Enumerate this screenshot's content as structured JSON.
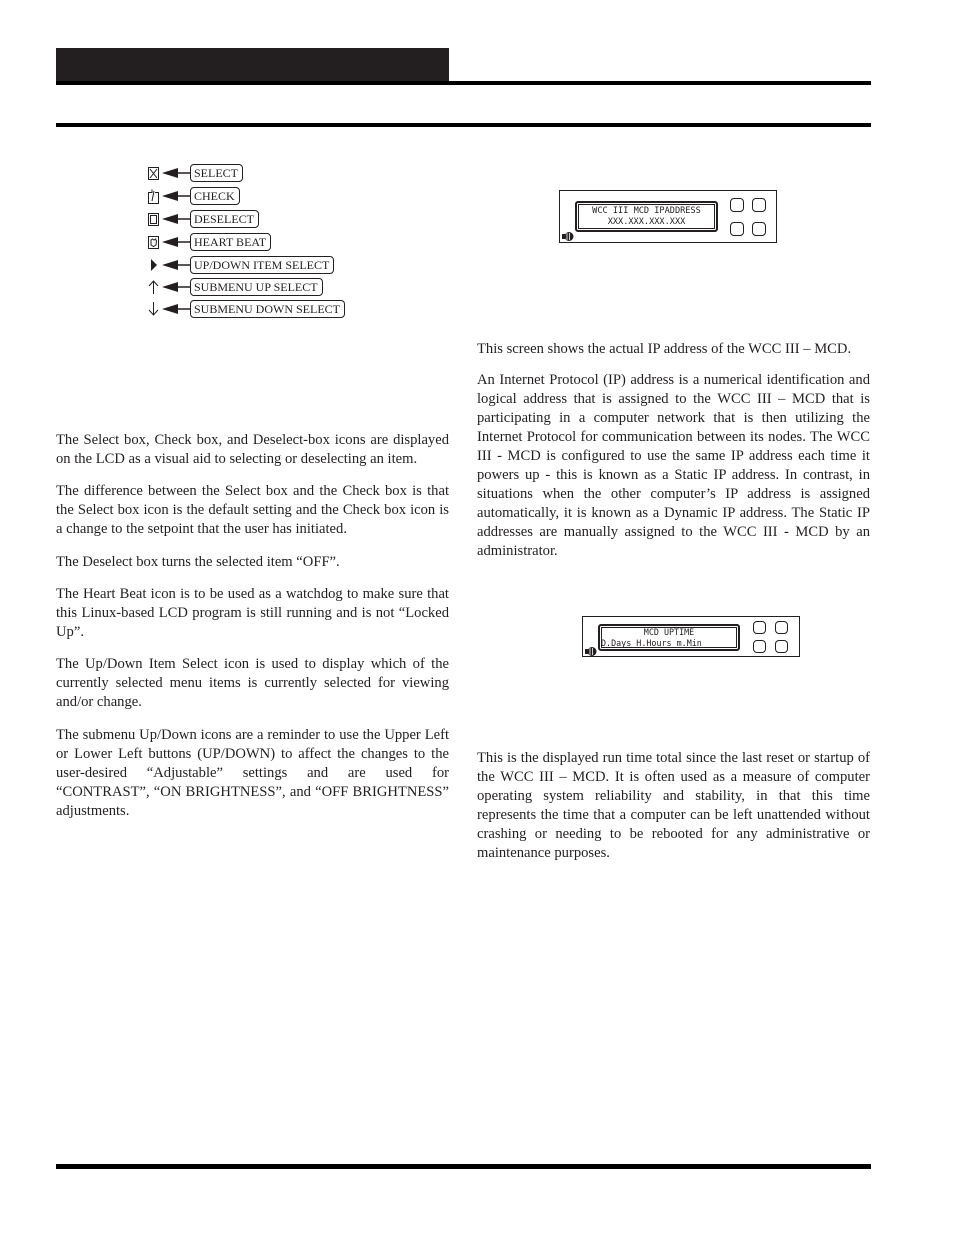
{
  "page": {
    "header_bar_color": "#231f20"
  },
  "legend": {
    "items": [
      {
        "icon": "select-box-icon",
        "label": "SELECT"
      },
      {
        "icon": "check-box-icon",
        "label": "CHECK"
      },
      {
        "icon": "deselect-box-icon",
        "label": "DESELECT"
      },
      {
        "icon": "heart-beat-icon",
        "label": "HEART BEAT"
      },
      {
        "icon": "up-down-item-select-icon",
        "label": "UP/DOWN ITEM SELECT"
      },
      {
        "icon": "submenu-up-arrow-icon",
        "label": "SUBMENU UP SELECT"
      },
      {
        "icon": "submenu-down-arrow-icon",
        "label": "SUBMENU DOWN SELECT"
      }
    ]
  },
  "left_column": {
    "paragraphs": [
      "The Select box, Check box, and Deselect-box icons are displayed on the LCD as a visual aid to selecting or deselecting an item.",
      "The difference between the Select box and the Check box is that the Select box icon is the default setting and the Check box icon is a change to the setpoint that the user has initiated.",
      "The Deselect box turns the selected item “OFF”.",
      "The Heart Beat icon is to be used as a watchdog to make sure that this Linux-based LCD program is still running and is not “Locked Up”.",
      "The Up/Down Item Select icon is used to display which of the currently selected menu items is currently selected for viewing and/or change.",
      "The submenu Up/Down icons are a reminder to use the Upper Left or Lower Left buttons (UP/DOWN) to affect the changes to the user-desired “Adjustable” settings and are used for “CONTRAST”, “ON BRIGHTNESS”, and “OFF BRIGHTNESS” adjustments."
    ]
  },
  "lcd_ip": {
    "line1": "WCC III MCD IPADDRESS",
    "line2": "XXX.XXX.XXX.XXX"
  },
  "lcd_uptime": {
    "line1": "MCD UPTIME",
    "line2": "D.Days H.Hours m.Min"
  },
  "right_column": {
    "ip_paragraphs": [
      "This screen shows the actual IP address of the WCC III – MCD.",
      "An Internet Protocol (IP) address is a numerical identification and logical address that is assigned to the WCC III – MCD that is participating in a computer network that is then utilizing the Internet Protocol for communication between its nodes. The WCC III - MCD is configured to use the same IP address each time it powers up - this is known as a Static IP address. In contrast, in situations when the other computer’s IP address is assigned automatically, it is known as a Dynamic IP address. The Static IP addresses are manually assigned to the WCC III - MCD by an administrator."
    ],
    "uptime_paragraphs": [
      "This is the displayed run time total since the last reset or startup of the WCC III – MCD. It is often used as a measure of computer operating system reliability and stability, in that this time represents the time that a computer can be left unattended without crashing or needing to be rebooted for any administrative or maintenance purposes."
    ]
  }
}
